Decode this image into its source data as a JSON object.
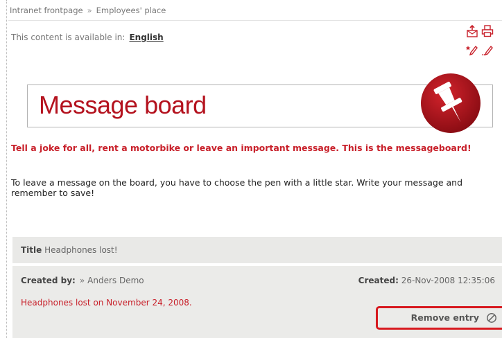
{
  "breadcrumb": {
    "items": [
      "Intranet frontpage",
      "Employees' place"
    ],
    "separator": "»"
  },
  "language": {
    "label": "This content is available in:",
    "link": "English"
  },
  "tools": {
    "icons": [
      "send-email-icon",
      "print-icon",
      "new-entry-pen-icon",
      "edit-pen-icon"
    ]
  },
  "banner": {
    "title": "Message board",
    "accent": "#b4121e"
  },
  "intro_text": "Tell a joke for all, rent a motorbike or leave an important message. This is the messageboard!",
  "instructions_text": "To leave a message on the board, you have to choose the pen with a little star. Write your message and remember to save!",
  "entry": {
    "title_label": "Title",
    "title": "Headphones lost!",
    "created_by_label": "Created by:",
    "author_marker": "»",
    "author": "Anders Demo",
    "created_label": "Created:",
    "created": "26-Nov-2008 12:35:06",
    "message": "Headphones lost on November 24, 2008.",
    "remove_label": "Remove entry",
    "highlight_color": "#d7191f"
  }
}
